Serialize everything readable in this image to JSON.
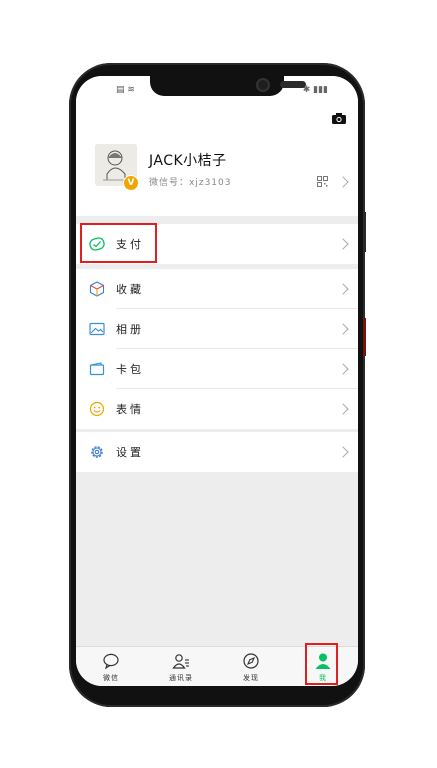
{
  "status_bar": {
    "left_icons": "▤ ≋",
    "right_icons": "✱ ▮▮▮"
  },
  "profile": {
    "nickname": "JACK小桔子",
    "wechat_id_label": "微信号：",
    "wechat_id_value": "xjz3103",
    "badge": "V"
  },
  "menu": {
    "pay": "支付",
    "favorites": "收藏",
    "album": "相册",
    "cards": "卡包",
    "stickers": "表情",
    "settings": "设置"
  },
  "tabs": [
    {
      "label": "微信",
      "icon": "chat-icon"
    },
    {
      "label": "通讯录",
      "icon": "contacts-icon"
    },
    {
      "label": "发现",
      "icon": "compass-icon"
    },
    {
      "label": "我",
      "icon": "person-icon",
      "active": true
    }
  ],
  "colors": {
    "accent_green": "#07c160",
    "highlight_red": "#e02020",
    "badge_orange": "#f0a500",
    "background_gray": "#ededed"
  }
}
